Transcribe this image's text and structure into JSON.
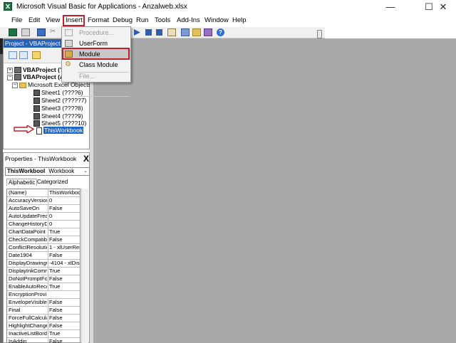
{
  "window": {
    "title": "Microsoft Visual Basic for Applications - Anzalweb.xlsx",
    "minimize": "—",
    "maximize": "☐",
    "close": "✕"
  },
  "menubar": {
    "items": [
      "File",
      "Edit",
      "View",
      "Insert",
      "Format",
      "Debug",
      "Run",
      "Tools",
      "Add-Ins",
      "Window",
      "Help"
    ]
  },
  "insert_menu": {
    "items": [
      {
        "label": "Procedure...",
        "enabled": false,
        "icon": "procedure-icon"
      },
      {
        "label": "UserForm",
        "enabled": true,
        "icon": "userform-icon"
      },
      {
        "label": "Module",
        "enabled": true,
        "icon": "module-icon",
        "highlighted": true
      },
      {
        "label": "Class Module",
        "enabled": true,
        "icon": "class-module-icon"
      },
      {
        "label": "File...",
        "enabled": false,
        "icon": ""
      }
    ]
  },
  "project_panel": {
    "title": "Project - VBAProject",
    "tree": {
      "project1": "VBAProject (?",
      "project2": "VBAProject (A",
      "folder": "Microsoft Excel Objects",
      "sheets": [
        "Sheet1 (????6)",
        "Sheet2 (?????7)",
        "Sheet3 (????8)",
        "Sheet4 (????9)",
        "Sheet5 (????10)"
      ],
      "workbook": "ThisWorkbook"
    }
  },
  "properties_panel": {
    "title": "Properties - ThisWorkbook",
    "close": "X",
    "object_name": "ThisWorkbool",
    "object_type": "Workbook",
    "tabs": [
      "Alphabetic",
      "Categorized"
    ],
    "rows": [
      [
        "(Name)",
        "ThisWorkbook"
      ],
      [
        "AccuracyVersion",
        "0"
      ],
      [
        "AutoSaveOn",
        "False"
      ],
      [
        "AutoUpdateFreq",
        "0"
      ],
      [
        "ChangeHistoryD",
        "0"
      ],
      [
        "ChartDataPoint",
        "True"
      ],
      [
        "CheckCompatibil",
        "False"
      ],
      [
        "ConflictResolutio",
        "1 - xlUserReso"
      ],
      [
        "Date1904",
        "False"
      ],
      [
        "DisplayDrawingO",
        "-4104 - xlDispl"
      ],
      [
        "DisplayInkComm",
        "True"
      ],
      [
        "DoNotPromptFo",
        "False"
      ],
      [
        "EnableAutoReco",
        "True"
      ],
      [
        "EncryptionProvi",
        ""
      ],
      [
        "EnvelopeVisible",
        "False"
      ],
      [
        "Final",
        "False"
      ],
      [
        "ForceFullCalcula",
        "False"
      ],
      [
        "HighlightChange",
        "False"
      ],
      [
        "InactiveListBord",
        "True"
      ],
      [
        "IsAddin",
        "False"
      ]
    ]
  },
  "colors": {
    "highlight_box": "#c0202c",
    "panel_header": "#2a61b8",
    "selection": "#1e66c8",
    "workspace": "#a9a9a9"
  }
}
